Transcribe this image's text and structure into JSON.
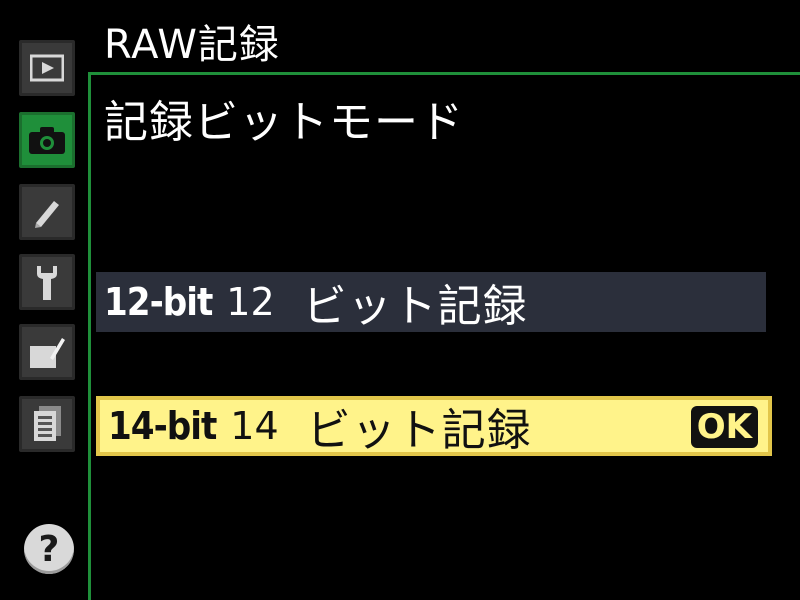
{
  "header": {
    "title": "RAW記録"
  },
  "section": {
    "title": "記録ビットモード"
  },
  "options": [
    {
      "bit": "12-bit",
      "number": "12",
      "description": "ビット記録",
      "selected": false
    },
    {
      "bit": "14-bit",
      "number": "14",
      "description": "ビット記録",
      "selected": true,
      "confirm_label": "OK"
    }
  ],
  "sidebar": {
    "tabs": [
      {
        "icon": "playback-icon",
        "active": false
      },
      {
        "icon": "camera-icon",
        "active": true
      },
      {
        "icon": "pencil-icon",
        "active": false
      },
      {
        "icon": "wrench-icon",
        "active": false
      },
      {
        "icon": "retouch-icon",
        "active": false
      },
      {
        "icon": "recent-settings-icon",
        "active": false
      }
    ],
    "help_label": "?"
  },
  "colors": {
    "accent": "#1f8f3a",
    "highlight": "#fff38a",
    "selected_border": "#e2c64a"
  }
}
